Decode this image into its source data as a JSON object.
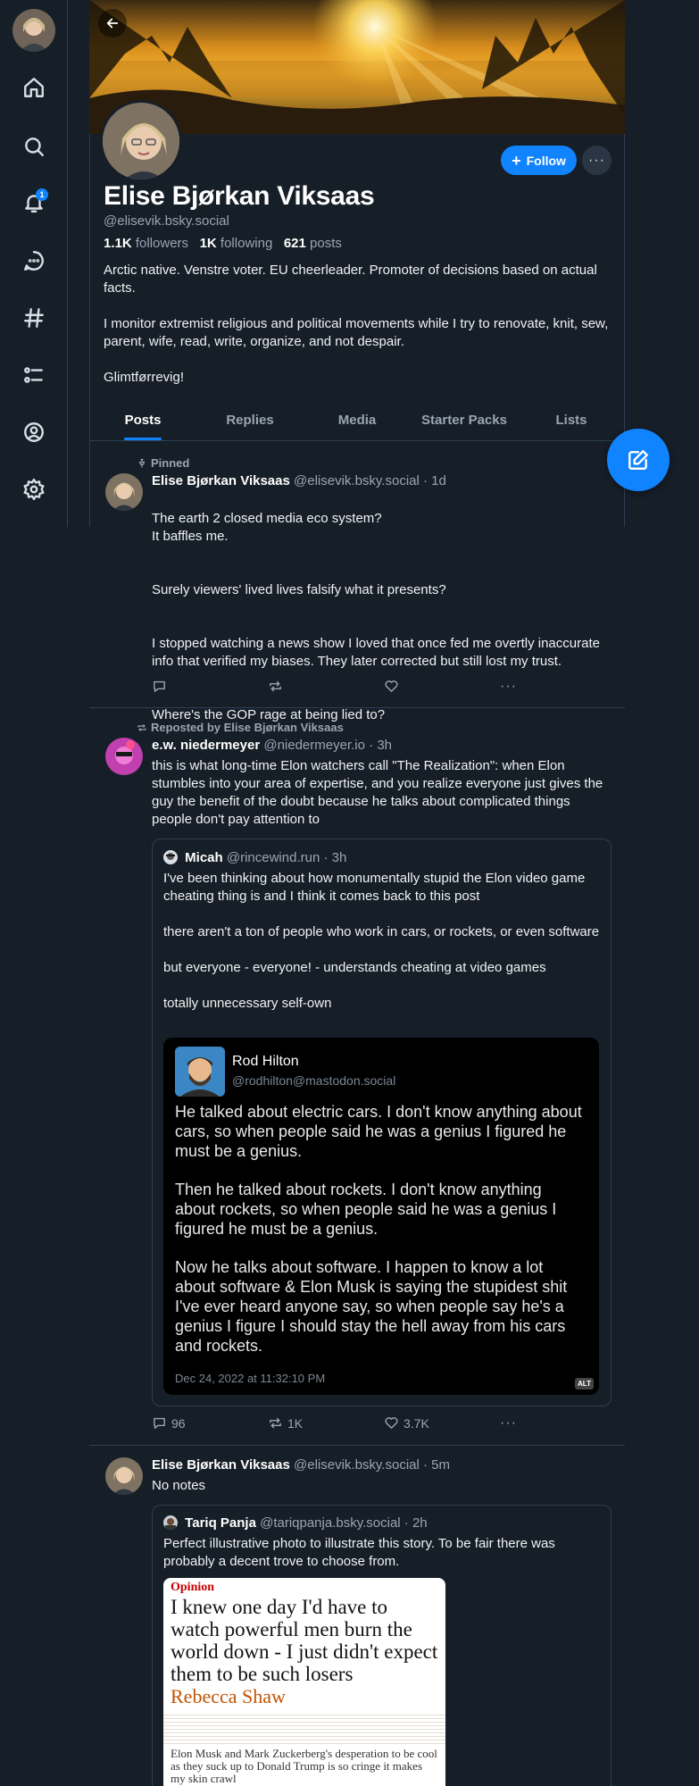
{
  "nav": {
    "notification_count": "1",
    "items": [
      "home-icon",
      "search-icon",
      "bell-icon",
      "chat-icon",
      "hashtag-icon",
      "lists-icon",
      "profile-icon",
      "settings-icon"
    ]
  },
  "profile": {
    "display_name": "Elise Bjørkan Viksaas",
    "handle": "@elisevik.bsky.social",
    "followers_count": "1.1K",
    "followers_label": "followers",
    "following_count": "1K",
    "following_label": "following",
    "posts_count": "621",
    "posts_label": "posts",
    "bio": [
      "Arctic native. Venstre voter. EU cheerleader. Promoter of decisions based on actual facts.",
      "I monitor extremist religious and political movements while I try to renovate, knit, sew, parent, wife, read, write, organize, and not despair.",
      "Glimtførrevig!"
    ],
    "follow_label": "Follow",
    "more_label": "···"
  },
  "tabs": [
    {
      "label": "Posts",
      "active": true
    },
    {
      "label": "Replies",
      "active": false
    },
    {
      "label": "Media",
      "active": false
    },
    {
      "label": "Starter Packs",
      "active": false
    },
    {
      "label": "Lists",
      "active": false
    }
  ],
  "posts": [
    {
      "context": "Pinned",
      "author_name": "Elise Bjørkan Viksaas",
      "author_handle": "@elisevik.bsky.social",
      "time": "1d",
      "paragraphs": [
        "The earth 2 closed media eco system?\nIt baffles me.",
        "Surely viewers' lived lives falsify what it presents?",
        "I stopped watching a news show I loved that once fed me overtly inaccurate info that verified my biases. They later corrected but still lost my trust.",
        "Where's the GOP rage at being lied to?"
      ]
    },
    {
      "context": "Reposted by Elise Bjørkan Viksaas",
      "author_name": "e.w. niedermeyer",
      "author_handle": "@niedermeyer.io",
      "time": "3h",
      "paragraphs": [
        "this is what long-time Elon watchers call \"The Realization\": when Elon stumbles into your area of expertise, and you realize everyone just gives the guy the benefit of the doubt because he talks about complicated things people don't pay attention to"
      ],
      "quote": {
        "author_name": "Micah",
        "author_handle": "@rincewind.run",
        "time": "3h",
        "paragraphs": [
          "I've been thinking about how monumentally stupid the Elon video game cheating thing is and I think it comes back to this post",
          "there aren't a ton of people who work in cars, or rockets, or even software",
          "but everyone - everyone! - understands cheating at video games",
          "totally unnecessary self-own"
        ],
        "image": {
          "name": "Rod Hilton",
          "handle": "@rodhilton@mastodon.social",
          "paragraphs": [
            "He talked about electric cars. I don't know anything about cars, so when people said he was a genius I figured he must be a genius.",
            "Then he talked about rockets. I don't know anything about rockets, so when people said he was a genius I figured he must be a genius.",
            "Now he talks about software. I happen to know a lot about software & Elon Musk is saying the stupidest shit I've ever heard anyone say, so when people say he's a genius I figure I should stay the hell away from his cars and rockets."
          ],
          "date": "Dec 24, 2022 at 11:32:10 PM",
          "alt_label": "ALT"
        }
      },
      "replies": "96",
      "reposts": "1K",
      "likes": "3.7K"
    },
    {
      "author_name": "Elise Bjørkan Viksaas",
      "author_handle": "@elisevik.bsky.social",
      "time": "5m",
      "paragraphs": [
        "No notes"
      ],
      "quote": {
        "author_name": "Tariq Panja",
        "author_handle": "@tariqpanja.bsky.social",
        "time": "2h",
        "text": "Perfect illustrative photo to illustrate this story. To be fair there was probably a decent trove to choose from.",
        "article": {
          "label": "Opinion",
          "headline": "I knew one day I'd have to watch powerful men burn the world down - I just didn't expect them to be such losers",
          "author": "Rebecca Shaw",
          "standfirst": "Elon Musk and Mark Zuckerberg's desperation to be cool as they suck up to Donald Trump is so cringe it makes my skin crawl"
        }
      }
    }
  ],
  "colors": {
    "background": "#161e27",
    "accent": "#1083fe",
    "muted": "#9aa6b3",
    "border": "#2e4052"
  }
}
